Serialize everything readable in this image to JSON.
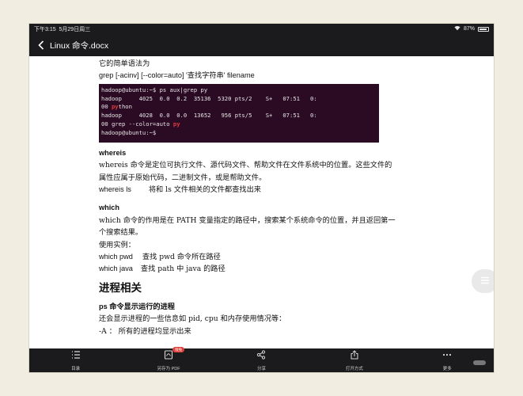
{
  "status": {
    "time": "下午3:15",
    "date": "5月29日周三",
    "battery": "87%"
  },
  "header": {
    "title": "Linux 命令.docx"
  },
  "doc": {
    "line1": "它的简单语法为",
    "line2": "grep [-acinv] [--color=auto] '查找字符串' filename",
    "terminal": [
      {
        "text": "hadoop@ubuntu:~$ ps aux|grep py"
      },
      {
        "text": "hadoop     4025  0.0  0.2  35136  5320 pts/2    S+   07:51   0:"
      },
      {
        "pre": "00 ",
        "hl": "py",
        "post": "thon"
      },
      {
        "text": "hadoop     4028  0.0  0.0  13652   956 pts/5    S+   07:51   0:"
      },
      {
        "pre": "00 grep --color=auto ",
        "hl": "py",
        "post": ""
      },
      {
        "text": "hadoop@ubuntu:~$ "
      }
    ],
    "whereis_title": "whereis",
    "whereis_desc1": "whereis 命令是定位可执行文件、源代码文件、帮助文件在文件系统中的位置。这些文件的",
    "whereis_desc2": "属性应属于原始代码，二进制文件，或是帮助文件。",
    "whereis_example_cmd": "whereis ls",
    "whereis_example_desc": "将和 ls 文件相关的文件都查找出来",
    "which_title": "which",
    "which_desc1": "which 命令的作用是在 PATH 变量指定的路径中，搜索某个系统命令的位置，并且返回第一",
    "which_desc2": "个搜索结果。",
    "which_usage": "使用实例：",
    "which_ex1_cmd": "which pwd",
    "which_ex1_desc": "查找 pwd 命令所在路径",
    "which_ex2_cmd": "which java",
    "which_ex2_desc": "查找 path 中 java 的路径",
    "section_title": "进程相关",
    "ps_title": "ps  命令显示运行的进程",
    "ps_desc": "还会显示进程的一些信息如 pid, cpu 和内存使用情况等：",
    "ps_opt": "-A  ：  所有的进程均显示出来"
  },
  "toolbar": {
    "toc": "目录",
    "save_pdf": "另存为 PDF",
    "badge": "限免",
    "share": "分享",
    "open_with": "打开方式",
    "more": "更多"
  }
}
